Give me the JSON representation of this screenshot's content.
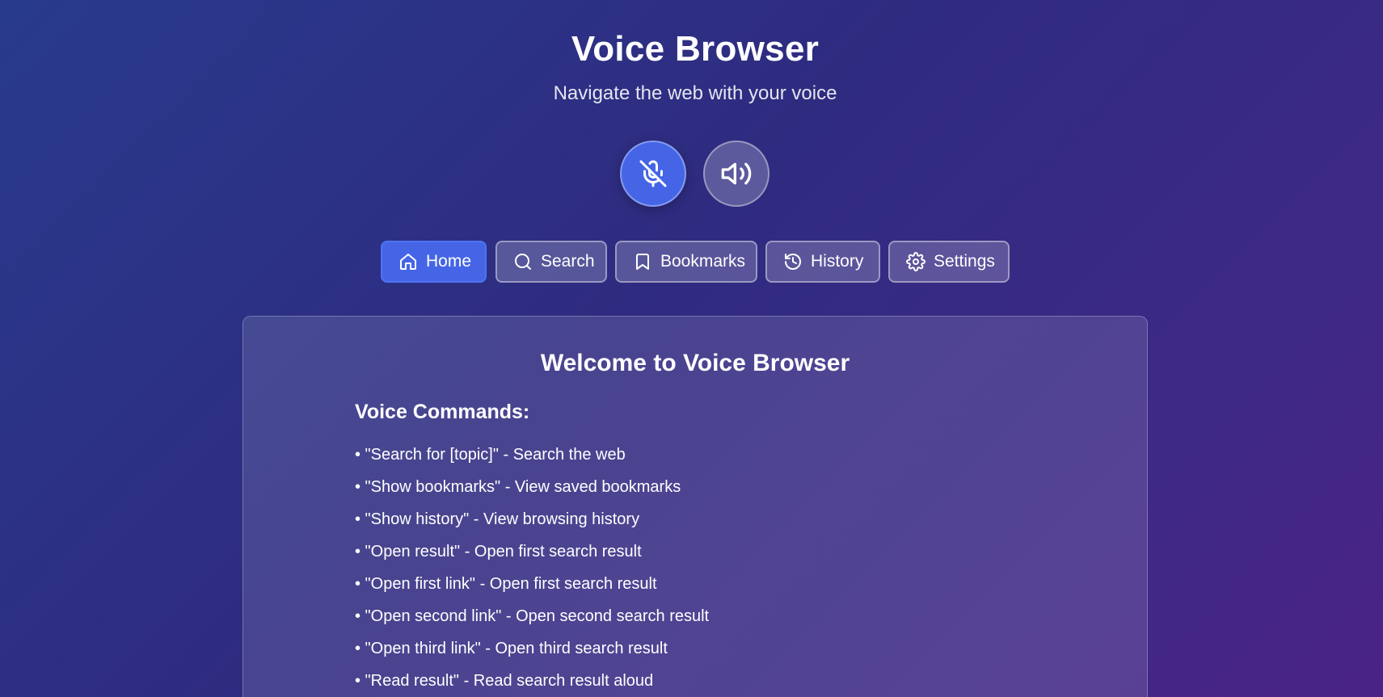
{
  "app": {
    "title": "Voice Browser",
    "subtitle": "Navigate the web with your voice"
  },
  "controls": {
    "mic": {
      "icon": "mic-off-icon",
      "state": "muted"
    },
    "speaker": {
      "icon": "volume-icon"
    }
  },
  "nav": [
    {
      "label": "Home",
      "icon": "home-icon",
      "active": true
    },
    {
      "label": "Search",
      "icon": "search-icon",
      "active": false
    },
    {
      "label": "Bookmarks",
      "icon": "bookmark-icon",
      "active": false
    },
    {
      "label": "History",
      "icon": "history-icon",
      "active": false
    },
    {
      "label": "Settings",
      "icon": "gear-icon",
      "active": false
    }
  ],
  "main": {
    "title": "Welcome to Voice Browser",
    "commands_heading": "Voice Commands:",
    "commands": [
      "• \"Search for [topic]\" - Search the web",
      "• \"Show bookmarks\" - View saved bookmarks",
      "• \"Show history\" - View browsing history",
      "• \"Open result\" - Open first search result",
      "• \"Open first link\" - Open first search result",
      "• \"Open second link\" - Open second search result",
      "• \"Open third link\" - Open third search result",
      "• \"Read result\" - Read search result aloud"
    ]
  },
  "colors": {
    "accent": "#4565e6",
    "background_start": "#283a8c",
    "background_end": "#4a2386"
  }
}
